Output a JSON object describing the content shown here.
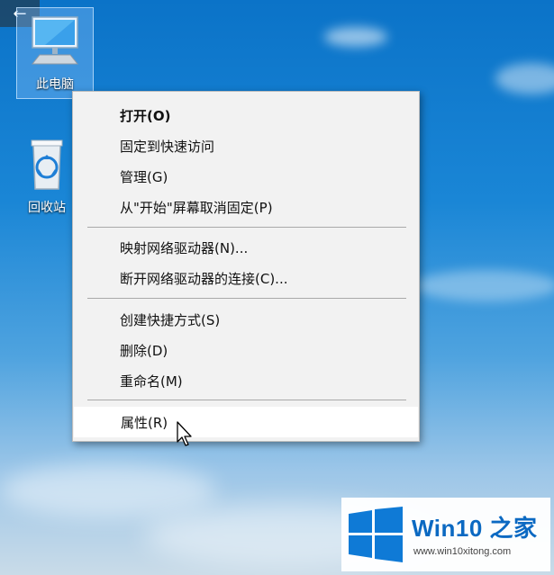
{
  "header": {
    "back_icon": "←"
  },
  "desktop_icons": [
    {
      "label": "此电脑",
      "icon": "computer-icon"
    },
    {
      "label": "回收站",
      "icon": "recycle-bin-icon"
    }
  ],
  "context_menu": {
    "items": [
      "打开(O)",
      "固定到快速访问",
      "管理(G)",
      "从\"开始\"屏幕取消固定(P)",
      "映射网络驱动器(N)...",
      "断开网络驱动器的连接(C)...",
      "创建快捷方式(S)",
      "删除(D)",
      "重命名(M)",
      "属性(R)"
    ],
    "highlighted": "属性(R)"
  },
  "watermark": {
    "brand": "Win10 之家",
    "url": "www.win10xitong.com"
  },
  "colors": {
    "accent": "#0f7ad6",
    "menu_bg": "#f2f2f2"
  }
}
